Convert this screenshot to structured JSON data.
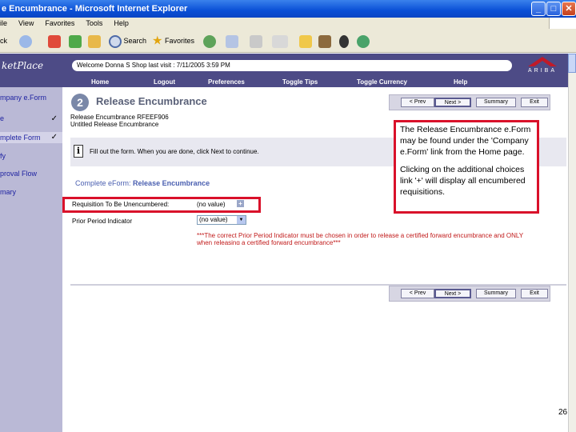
{
  "window": {
    "title": "e Encumbrance - Microsoft Internet Explorer",
    "controls": [
      "_",
      "□",
      "✕"
    ]
  },
  "menu": [
    "ile",
    "View",
    "Favorites",
    "Tools",
    "Help"
  ],
  "toolbar": {
    "back": "ck",
    "search": "Search",
    "favorites": "Favorites"
  },
  "nav": {
    "brand": "ketPlace",
    "items": [
      {
        "label": "e",
        "checked": true
      },
      {
        "label": "mpany e.Form",
        "checked": false
      },
      {
        "label": "mplete Form",
        "checked": true
      },
      {
        "label": "fy",
        "checked": false
      },
      {
        "label": "proval Flow",
        "checked": false
      },
      {
        "label": "mary",
        "checked": false
      }
    ],
    "check": "✓"
  },
  "header": {
    "welcome": "Welcome Donna S Shop   last visit : 7/11/2005 3:59 PM",
    "logo": "ARIBA",
    "links": [
      "Home",
      "Logout",
      "Preferences",
      "Toggle Tips",
      "Toggle Currency",
      "Help"
    ]
  },
  "form": {
    "step": "2",
    "title": "Release Encumbrance",
    "buttons": [
      "< Prev",
      "Next >",
      "Summary",
      "Exit"
    ],
    "doc_id": "Release Encumbrance RFEEF906",
    "doc_name": "Untitled Release Encumbrance",
    "info": "Fill out the form. When you are done, click Next to continue.",
    "section": {
      "prefix": "Complete eForm:",
      "name": "Release Encumbrance"
    },
    "requisition": {
      "label": "Requisition To Be Unencumbered:",
      "value": "(no value)",
      "add": "+"
    },
    "prior_period": {
      "label": "Prior Period Indicator",
      "value": "(no value)",
      "arrow": "▼"
    },
    "warning": "***The correct Prior Period Indicator must be chosen in order to release a certified forward encumbrance and ONLY when releasing a certified forward encumbrance***"
  },
  "callout": {
    "p1": "The Release Encumbrance e.Form may be found under the 'Company e.Form' link from the Home page.",
    "p2": "Clicking on the additional choices link '+' will display all encumbered requisitions."
  },
  "slide_number": "26",
  "colors": {
    "brand": "#4d4b86",
    "highlight": "#d9112a"
  }
}
